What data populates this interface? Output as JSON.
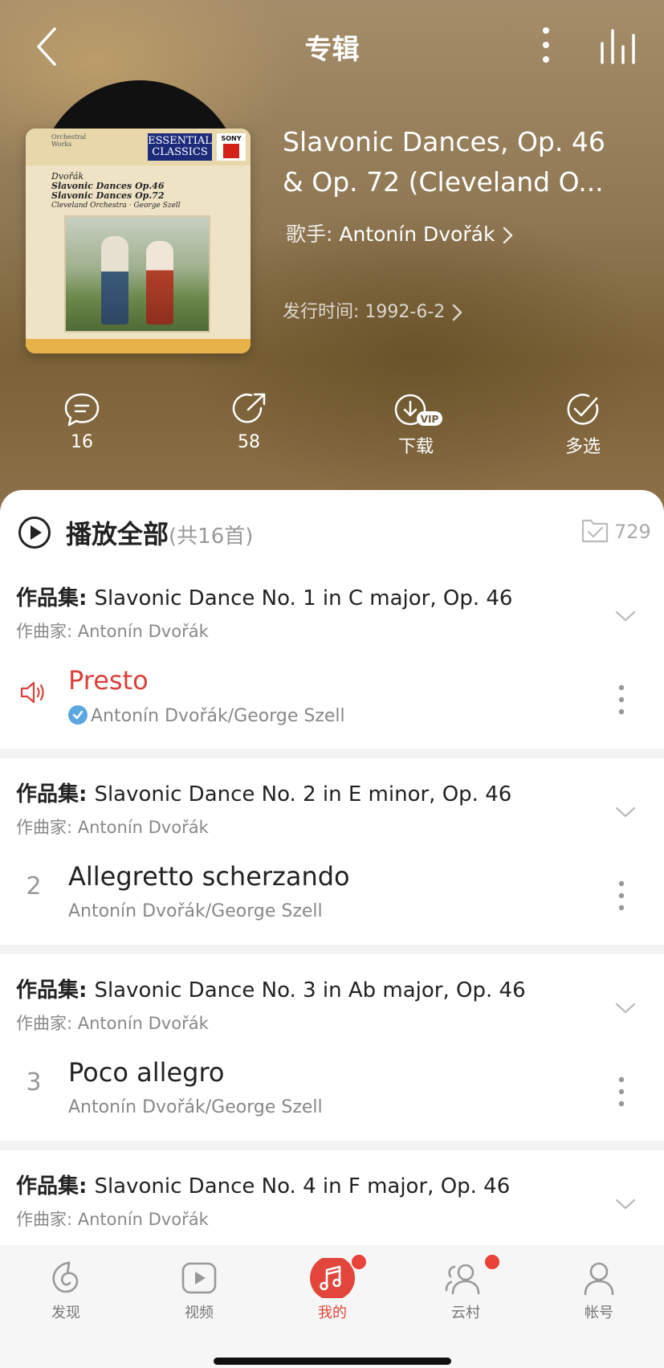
{
  "header": {
    "title": "专辑"
  },
  "album": {
    "title_line1": "Slavonic Dances, Op. 46",
    "title_line2": "& Op. 72 (Cleveland O...",
    "artist_label": "歌手: ",
    "artist_name": "Antonín Dvořák",
    "release": "发行时间: 1992-6-2",
    "cover": {
      "series_logo": "Orchestral Works",
      "badge": "ESSENTIAL CLASSICS",
      "label": "SONY",
      "composer": "Dvořák",
      "line1": "Slavonic Dances Op.46",
      "line2": "Slavonic Dances Op.72",
      "line3": "Cleveland Orchestra · George Szell"
    }
  },
  "actions": {
    "comments": "16",
    "share": "58",
    "download": "下载",
    "download_badge": "VIP",
    "multi_select": "多选"
  },
  "list": {
    "play_all": "播放全部",
    "count": "(共16首)",
    "collect_count": "729",
    "groups": [
      {
        "prefix": "作品集: ",
        "title": "Slavonic Dance No. 1 in C major, Op. 46",
        "composer": "作曲家: Antonín Dvořák",
        "song": {
          "index": "",
          "name": "Presto",
          "artist": "Antonín Dvořák/George Szell",
          "playing": true
        }
      },
      {
        "prefix": "作品集: ",
        "title": "Slavonic Dance No. 2 in E minor, Op. 46",
        "composer": "作曲家: Antonín Dvořák",
        "song": {
          "index": "2",
          "name": "Allegretto scherzando",
          "artist": "Antonín Dvořák/George Szell",
          "playing": false
        }
      },
      {
        "prefix": "作品集: ",
        "title": "Slavonic Dance No. 3 in Ab major, Op. 46",
        "composer": "作曲家: Antonín Dvořák",
        "song": {
          "index": "3",
          "name": "Poco allegro",
          "artist": "Antonín Dvořák/George Szell",
          "playing": false
        }
      },
      {
        "prefix": "作品集: ",
        "title": "Slavonic Dance No. 4 in F major, Op. 46",
        "composer": "作曲家: Antonín Dvořák"
      }
    ]
  },
  "nav": {
    "items": [
      {
        "label": "发现",
        "icon": "discover-icon"
      },
      {
        "label": "视频",
        "icon": "video-icon"
      },
      {
        "label": "我的",
        "icon": "music-note-icon",
        "active": true,
        "badge": true
      },
      {
        "label": "云村",
        "icon": "community-icon",
        "badge": true
      },
      {
        "label": "帐号",
        "icon": "account-icon"
      }
    ]
  },
  "colors": {
    "accent": "#e2463a",
    "playing": "#d9413a",
    "verified": "#5aa7e0"
  }
}
